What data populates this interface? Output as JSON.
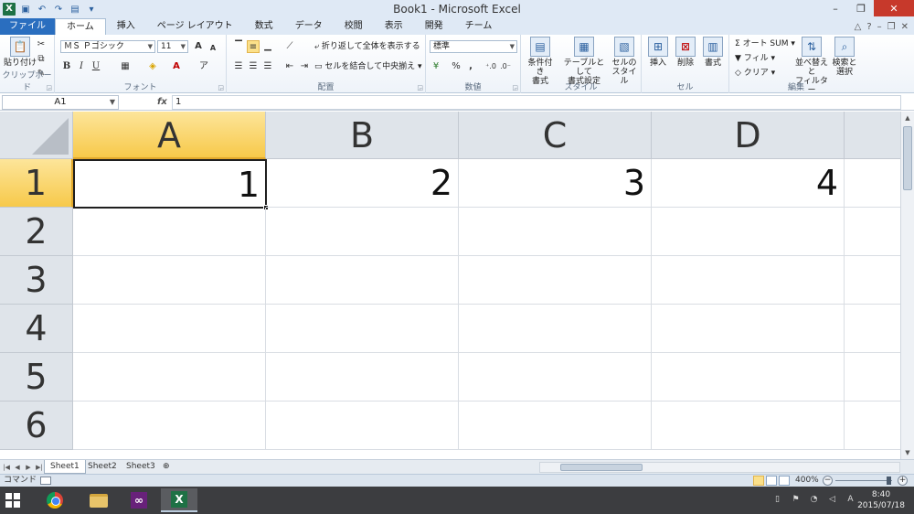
{
  "window": {
    "title": "Book1 - Microsoft Excel",
    "logo": "X",
    "controls": {
      "minimize": "–",
      "restore": "❐",
      "close": "✕"
    }
  },
  "quick_access": [
    "save-icon",
    "undo-icon",
    "redo-icon",
    "print-preview-icon",
    "customize-icon"
  ],
  "ribbon_tabs": [
    {
      "label": "ファイル"
    },
    {
      "label": "ホーム"
    },
    {
      "label": "挿入"
    },
    {
      "label": "ページ レイアウト"
    },
    {
      "label": "数式"
    },
    {
      "label": "データ"
    },
    {
      "label": "校閲"
    },
    {
      "label": "表示"
    },
    {
      "label": "開発"
    },
    {
      "label": "チーム"
    }
  ],
  "ribbon_right": {
    "minimize": "△",
    "help": "?",
    "restore": "❐",
    "close": "✕"
  },
  "ribbon": {
    "clipboard": {
      "label": "クリップボード",
      "paste": "貼り付け"
    },
    "font": {
      "label": "フォント",
      "font_name": "ＭＳ Ｐゴシック",
      "font_size": "11",
      "bold": "B",
      "italic": "I",
      "underline": "U",
      "grow": "A",
      "shrink": "A"
    },
    "alignment": {
      "label": "配置",
      "wrap_text": "折り返して全体を表示する",
      "merge_center": "セルを結合して中央揃え"
    },
    "number": {
      "label": "数値",
      "format": "標準",
      "percent": "%",
      "comma": ","
    },
    "styles": {
      "label": "スタイル",
      "conditional": "条件付き\n書式",
      "table": "テーブルとして\n書式設定",
      "cell_styles": "セルの\nスタイル"
    },
    "cells": {
      "label": "セル",
      "insert": "挿入",
      "delete": "削除",
      "format": "書式"
    },
    "editing": {
      "label": "編集",
      "autosum": "オート SUM",
      "fill": "フィル",
      "clear": "クリア",
      "sort": "並べ替えと\nフィルター",
      "find": "検索と\n選択"
    }
  },
  "formula_bar": {
    "name_box": "A1",
    "fx": "fx",
    "value": "1"
  },
  "grid": {
    "columns": [
      "A",
      "B",
      "C",
      "D"
    ],
    "rows": [
      "1",
      "2",
      "3",
      "4",
      "5",
      "6"
    ],
    "active_cell": "A1",
    "cells": {
      "A1": "1",
      "B1": "2",
      "C1": "3",
      "D1": "4"
    }
  },
  "sheets": [
    {
      "label": "Sheet1"
    },
    {
      "label": "Sheet2"
    },
    {
      "label": "Sheet3"
    }
  ],
  "status": {
    "mode": "コマンド",
    "zoom": "400%"
  },
  "taskbar": {
    "time": "8:40",
    "date": "2015/07/18",
    "ime": "A"
  },
  "colors": {
    "accent": "#2a6ebf",
    "excel": "#1e7145",
    "header_active": "#f7c94a"
  }
}
